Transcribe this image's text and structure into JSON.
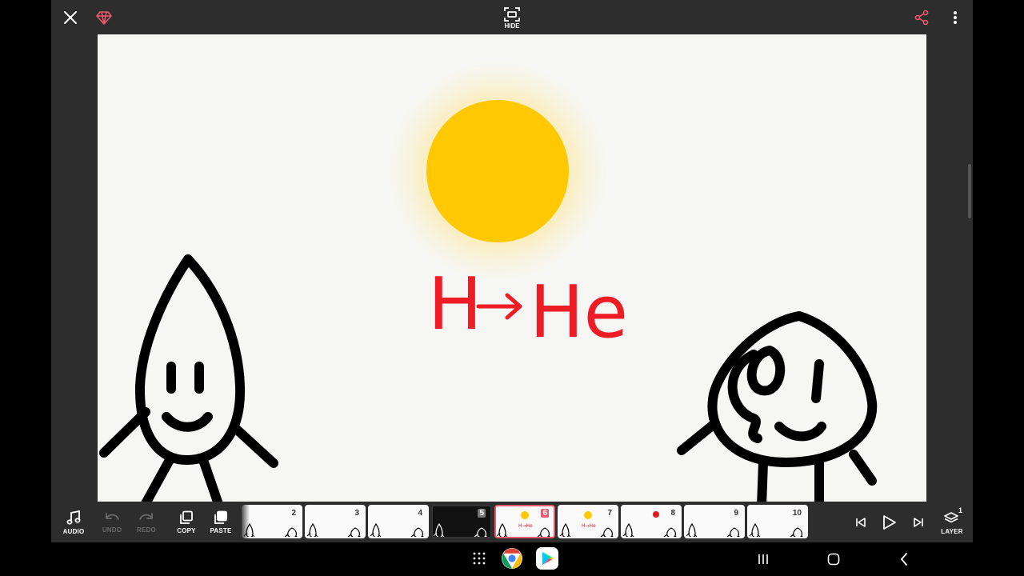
{
  "topbar": {
    "close_icon": "close-icon",
    "premium_icon": "diamond-icon",
    "hide_label": "HIDE",
    "share_icon": "share-icon",
    "more_icon": "more-vertical-icon",
    "accent_color": "#e9596f"
  },
  "canvas": {
    "equation_left": "H",
    "equation_right": "He",
    "sun_color": "#ffc800",
    "text_color": "#ee1c25"
  },
  "toolbar": {
    "audio_label": "AUDIO",
    "undo_label": "UNDO",
    "redo_label": "REDO",
    "copy_label": "COPY",
    "paste_label": "PASTE",
    "layer_label": "LAYER",
    "layer_count": "1"
  },
  "frames": [
    {
      "num": "2",
      "state": "normal"
    },
    {
      "num": "3",
      "state": "normal"
    },
    {
      "num": "4",
      "state": "normal"
    },
    {
      "num": "5",
      "state": "current"
    },
    {
      "num": "6",
      "state": "selected"
    },
    {
      "num": "7",
      "state": "normal"
    },
    {
      "num": "8",
      "state": "normal"
    },
    {
      "num": "9",
      "state": "normal"
    },
    {
      "num": "10",
      "state": "normal"
    }
  ],
  "frame_thumb_text": "H→He",
  "playback": {
    "prev_icon": "skip-to-start-icon",
    "play_icon": "play-icon",
    "next_icon": "skip-to-end-icon"
  },
  "navbar": {
    "apps_icon": "app-grid-icon",
    "chrome_icon": "chrome-icon",
    "play_store_icon": "play-store-icon",
    "recents_icon": "recents-icon",
    "home_icon": "home-icon",
    "back_icon": "back-icon"
  }
}
